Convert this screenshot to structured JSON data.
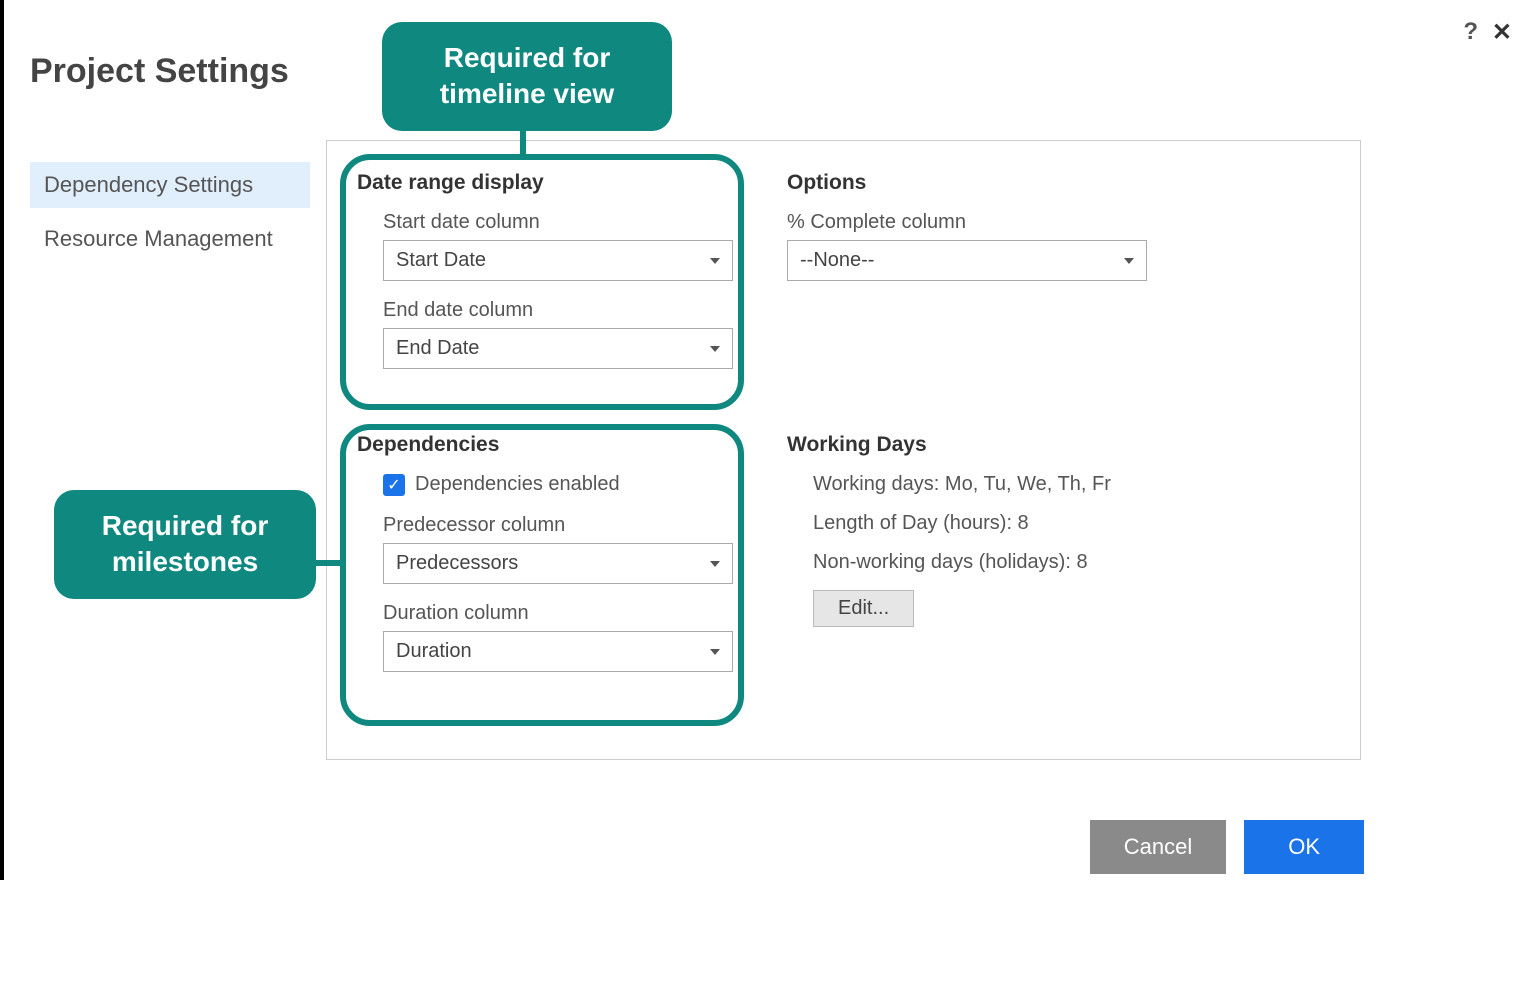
{
  "title": "Project Settings",
  "help_symbol": "?",
  "close_symbol": "✕",
  "sidebar": {
    "items": [
      {
        "label": "Dependency Settings",
        "active": true
      },
      {
        "label": "Resource Management",
        "active": false
      }
    ]
  },
  "callouts": {
    "timeline": "Required for timeline view",
    "milestones": "Required for milestones"
  },
  "sections": {
    "date_range": {
      "heading": "Date range display",
      "start_label": "Start date column",
      "start_value": "Start Date",
      "end_label": "End date column",
      "end_value": "End Date"
    },
    "options": {
      "heading": "Options",
      "complete_label": "% Complete column",
      "complete_value": "--None--"
    },
    "dependencies": {
      "heading": "Dependencies",
      "enabled_label": "Dependencies enabled",
      "enabled_checked": true,
      "predecessor_label": "Predecessor column",
      "predecessor_value": "Predecessors",
      "duration_label": "Duration column",
      "duration_value": "Duration"
    },
    "working_days": {
      "heading": "Working Days",
      "days_line": "Working days: Mo, Tu, We, Th, Fr",
      "length_line": "Length of Day (hours): 8",
      "nonworking_line": "Non-working days (holidays): 8",
      "edit_label": "Edit..."
    }
  },
  "buttons": {
    "cancel": "Cancel",
    "ok": "OK"
  }
}
